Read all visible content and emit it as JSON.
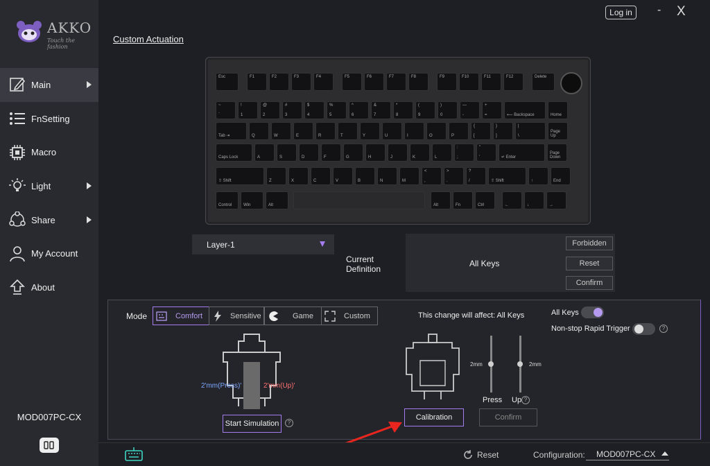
{
  "brand": {
    "name": "AKKO",
    "tagline": "Touch the fashion"
  },
  "topbar": {
    "login_label": "Log in",
    "minimize": "-",
    "close": "X"
  },
  "sidebar": {
    "items": [
      {
        "label": "Main",
        "icon": "pencil-icon",
        "arrow": true,
        "active": true
      },
      {
        "label": "FnSetting",
        "icon": "list-icon",
        "arrow": false
      },
      {
        "label": "Macro",
        "icon": "chip-icon",
        "arrow": false
      },
      {
        "label": "Light",
        "icon": "bulb-icon",
        "arrow": true
      },
      {
        "label": "Share",
        "icon": "share-icon",
        "arrow": true
      },
      {
        "label": "My Account",
        "icon": "user-icon",
        "arrow": false
      },
      {
        "label": "About",
        "icon": "upload-icon",
        "arrow": false
      }
    ],
    "device_name": "MOD007PC-CX"
  },
  "page_title": "Custom Actuation",
  "keyboard": {
    "row1": [
      "Esc",
      "F1",
      "F2",
      "F3",
      "F4",
      "F5",
      "F6",
      "F7",
      "F8",
      "F9",
      "F10",
      "F11",
      "F12",
      "Delete"
    ],
    "row2": [
      [
        "~",
        "`"
      ],
      [
        "!",
        "1"
      ],
      [
        "@",
        "2"
      ],
      [
        "#",
        "3"
      ],
      [
        "$",
        "4"
      ],
      [
        "%",
        "5"
      ],
      [
        "^",
        "6"
      ],
      [
        "&",
        "7"
      ],
      [
        "*",
        "8"
      ],
      [
        "(",
        "9"
      ],
      [
        ")",
        "0"
      ],
      [
        "—",
        "-"
      ],
      [
        "+",
        "="
      ],
      [
        "",
        "⟵ Backspace"
      ],
      [
        "",
        "Home"
      ]
    ],
    "row3": [
      [
        "",
        "Tab ⇥"
      ],
      [
        "",
        "Q"
      ],
      [
        "",
        "W"
      ],
      [
        "",
        "E"
      ],
      [
        "",
        "R"
      ],
      [
        "",
        "T"
      ],
      [
        "",
        "Y"
      ],
      [
        "",
        "U"
      ],
      [
        "",
        "I"
      ],
      [
        "",
        "O"
      ],
      [
        "",
        "P"
      ],
      [
        "{",
        "["
      ],
      [
        "}",
        "]"
      ],
      [
        "|",
        "\\"
      ],
      [
        "",
        "Page Up"
      ]
    ],
    "row4": [
      [
        "",
        "Caps Lock"
      ],
      [
        "",
        "A"
      ],
      [
        "",
        "S"
      ],
      [
        "",
        "D"
      ],
      [
        "",
        "F"
      ],
      [
        "",
        "G"
      ],
      [
        "",
        "H"
      ],
      [
        "",
        "J"
      ],
      [
        "",
        "K"
      ],
      [
        "",
        "L"
      ],
      [
        ":",
        ";"
      ],
      [
        "\"",
        "'"
      ],
      [
        "",
        "↵ Enter"
      ],
      [
        "",
        "Page Down"
      ]
    ],
    "row5": [
      [
        "",
        "⇧ Shift"
      ],
      [
        "",
        "Z"
      ],
      [
        "",
        "X"
      ],
      [
        "",
        "C"
      ],
      [
        "",
        "V"
      ],
      [
        "",
        "B"
      ],
      [
        "",
        "N"
      ],
      [
        "",
        "M"
      ],
      [
        "<",
        ","
      ],
      [
        ">",
        "."
      ],
      [
        "?",
        "/"
      ],
      [
        "",
        "⇧ Shift"
      ],
      [
        "",
        "↑"
      ],
      [
        "",
        "End"
      ]
    ],
    "row6": [
      [
        "",
        "Control"
      ],
      [
        "",
        "Win"
      ],
      [
        "",
        "Alt"
      ],
      [
        "",
        ""
      ],
      [
        "",
        "Alt"
      ],
      [
        "",
        "Fn"
      ],
      [
        "",
        "Ctrl"
      ],
      [
        "",
        "←"
      ],
      [
        "",
        "↓"
      ],
      [
        "",
        "→"
      ]
    ]
  },
  "layer": {
    "selected": "Layer-1"
  },
  "current_definition": {
    "label_line1": "Current",
    "label_line2": "Definition",
    "value": "All Keys"
  },
  "actions": {
    "forbidden": "Forbidden",
    "reset": "Reset",
    "confirm": "Confirm"
  },
  "mode": {
    "label": "Mode",
    "tabs": [
      {
        "label": "Comfort",
        "icon": "comfort-icon",
        "active": true
      },
      {
        "label": "Sensitive",
        "icon": "lightning-icon",
        "active": false
      },
      {
        "label": "Game",
        "icon": "pacman-icon",
        "active": false
      },
      {
        "label": "Custom",
        "icon": "custom-icon",
        "active": false
      }
    ]
  },
  "simulation": {
    "press_label": "2'mm(Press)'",
    "up_label": "2'mm(Up)'",
    "start_label": "Start Simulation"
  },
  "affect": {
    "text": "This change will affect:  All Keys"
  },
  "toggles": {
    "all_keys": {
      "label": "All Keys",
      "on": true
    },
    "rapid": {
      "label": "Non-stop Rapid Trigger",
      "on": false
    }
  },
  "calibration": {
    "button": "Calibration",
    "confirm": "Confirm",
    "press_mm": "2mm",
    "up_mm": "2mm",
    "press_label": "Press",
    "up_label": "Up"
  },
  "footer": {
    "reset": "Reset",
    "config_label": "Configuration:",
    "config_value": "MOD007PC-CX"
  },
  "colors": {
    "accent": "#a47ef0",
    "press": "#7ea7ff",
    "up": "#ff7070"
  }
}
